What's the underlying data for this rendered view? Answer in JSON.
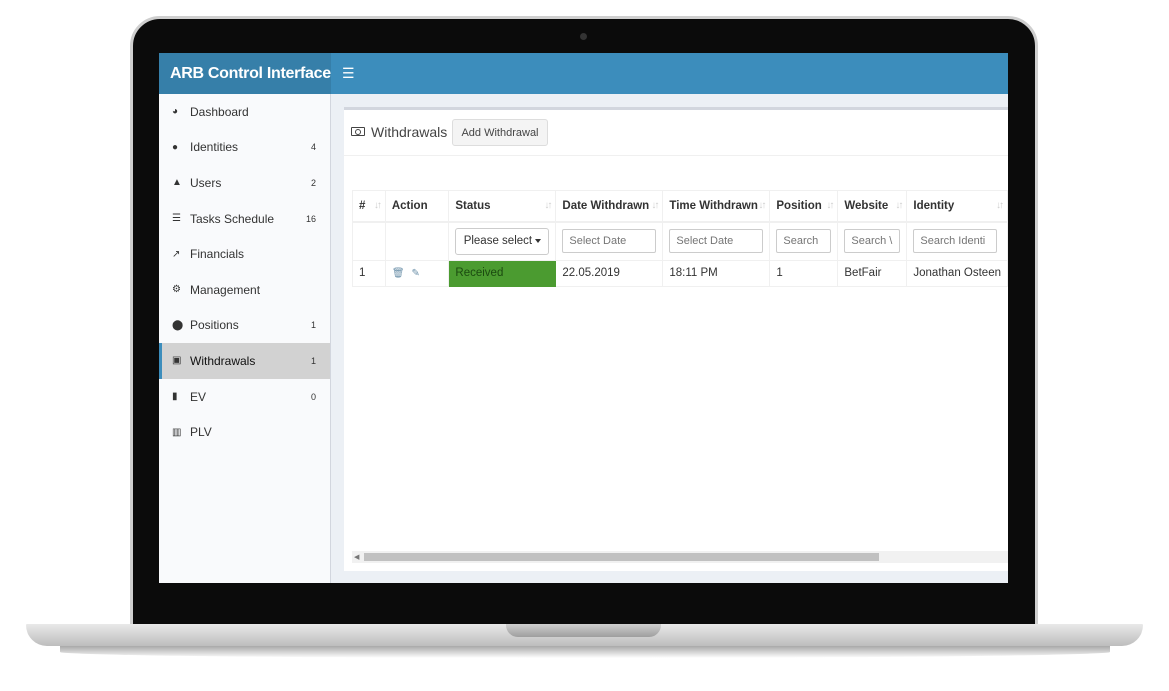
{
  "app": {
    "brand": "ARB Control Interface",
    "menu_icon": "hamburger-icon"
  },
  "sidebar": {
    "items": [
      {
        "label": "Dashboard",
        "icon": "dashboard-icon",
        "badge": ""
      },
      {
        "label": "Identities",
        "icon": "user-icon",
        "badge": "4"
      },
      {
        "label": "Users",
        "icon": "user-secret-icon",
        "badge": "2"
      },
      {
        "label": "Tasks Schedule",
        "icon": "tasks-icon",
        "badge": "16"
      },
      {
        "label": "Financials",
        "icon": "line-chart-icon",
        "badge": ""
      },
      {
        "label": "Management",
        "icon": "cogs-icon",
        "badge": ""
      },
      {
        "label": "Positions",
        "icon": "circle-icon",
        "badge": "1"
      },
      {
        "label": "Withdrawals",
        "icon": "money-icon",
        "badge": "1",
        "active": true
      },
      {
        "label": "EV",
        "icon": "bookmark-icon",
        "badge": "0"
      },
      {
        "label": "PLV",
        "icon": "bar-chart-icon",
        "badge": ""
      }
    ]
  },
  "main": {
    "title": "Withdrawals",
    "add_button": "Add Withdrawal",
    "table": {
      "headers": [
        "#",
        "Action",
        "Status",
        "Date Withdrawn",
        "Time Withdrawn",
        "Position",
        "Website",
        "Identity"
      ],
      "filters": {
        "status": "Please select",
        "date": "Select Date",
        "time": "Select Date",
        "position": "Search",
        "website": "Search \\",
        "identity": "Search Identi"
      },
      "rows": [
        {
          "id": "1",
          "status": "Received",
          "date": "22.05.2019",
          "time": "18:11 PM",
          "position": "1",
          "website": "BetFair",
          "identity": "Jonathan Osteen"
        }
      ]
    }
  },
  "colors": {
    "header": "#3c8dbc",
    "brand": "#367fa9",
    "received": "#4b9b30"
  }
}
